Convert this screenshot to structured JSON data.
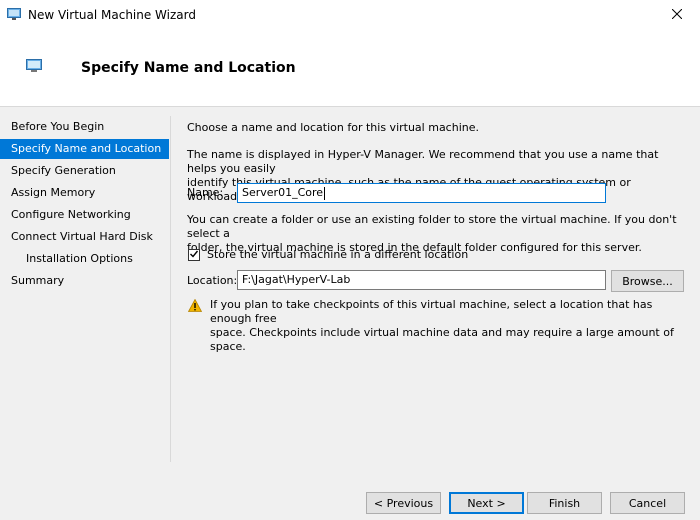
{
  "window": {
    "title": "New Virtual Machine Wizard"
  },
  "header": {
    "title": "Specify Name and Location"
  },
  "nav": {
    "items": [
      {
        "label": "Before You Begin"
      },
      {
        "label": "Specify Name and Location"
      },
      {
        "label": "Specify Generation"
      },
      {
        "label": "Assign Memory"
      },
      {
        "label": "Configure Networking"
      },
      {
        "label": "Connect Virtual Hard Disk"
      },
      {
        "label": "Installation Options"
      },
      {
        "label": "Summary"
      }
    ]
  },
  "main": {
    "intro": "Choose a name and location for this virtual machine.",
    "name_desc_line1": "The name is displayed in Hyper-V Manager. We recommend that you use a name that helps you easily",
    "name_desc_line2": "identify this virtual machine, such as the name of the guest operating system or workload.",
    "name_label": "Name:",
    "name_value": "Server01_Core",
    "folder_desc_line1": "You can create a folder or use an existing folder to store the virtual machine. If you don't select a",
    "folder_desc_line2": "folder, the virtual machine is stored in the default folder configured for this server.",
    "checkbox_label": "Store the virtual machine in a different location",
    "checkbox_checked": true,
    "location_label": "Location:",
    "location_value": "F:\\Jagat\\HyperV-Lab",
    "browse_label": "Browse...",
    "warning_line1": "If you plan to take checkpoints of this virtual machine, select a location that has enough free",
    "warning_line2": "space. Checkpoints include virtual machine data and may require a large amount of space."
  },
  "buttons": {
    "previous": "< Previous",
    "next": "Next >",
    "finish": "Finish",
    "cancel": "Cancel"
  },
  "icons": {
    "window": "vm-monitor-icon",
    "header": "vm-monitor-icon",
    "close": "close-icon",
    "warning": "warning-icon",
    "checkbox": "checkmark-icon"
  },
  "colors": {
    "accent": "#0078d7",
    "warning": "#f0b400"
  }
}
